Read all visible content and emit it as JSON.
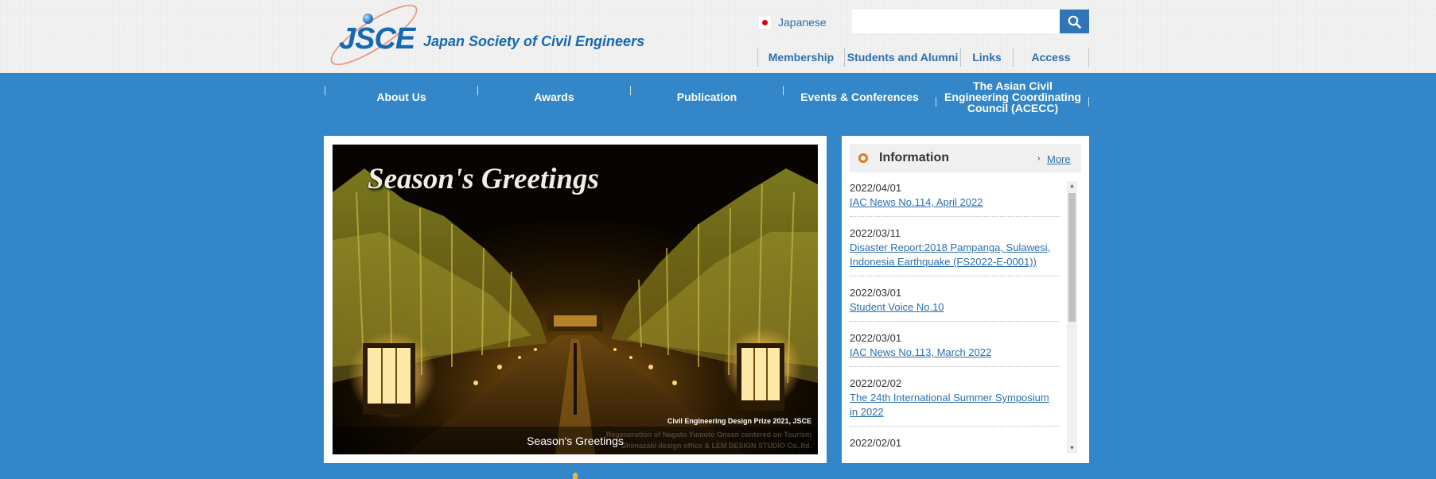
{
  "site": {
    "logo_mark": "JSCE",
    "logo_name": "Japan Society of Civil Engineers"
  },
  "language": {
    "label": "Japanese"
  },
  "search": {
    "placeholder": ""
  },
  "subnav": [
    {
      "label": "Membership"
    },
    {
      "label": "Students and Alumni"
    },
    {
      "label": "Links"
    },
    {
      "label": "Access"
    }
  ],
  "mainnav": [
    {
      "label": "About Us"
    },
    {
      "label": "Awards"
    },
    {
      "label": "Publication"
    },
    {
      "label": "Events & Conferences"
    },
    {
      "label": "The Asian Civil Engineering Coordinating Council (ACECC)"
    }
  ],
  "slider": {
    "headline": "Season's Greetings",
    "credit": "Civil Engineering Design Prize 2021, JSCE",
    "credit_line2": "Regeneration of Nagato Yumoto Onsen centered on Tourism",
    "credit_line3": "Shimazaki design office & LEM DESIGN STUDIO Co.,ltd.",
    "caption": "Season's Greetings"
  },
  "information": {
    "title": "Information",
    "more_label": "More",
    "items": [
      {
        "date": "2022/04/01",
        "link": "IAC News No.114, April 2022"
      },
      {
        "date": "2022/03/11",
        "link": "Disaster Report:2018 Pampanga, Sulawesi, Indonesia Earthquake (FS2022-E-0001))"
      },
      {
        "date": "2022/03/01",
        "link": "Student Voice No.10"
      },
      {
        "date": "2022/03/01",
        "link": "IAC News No.113, March 2022"
      },
      {
        "date": "2022/02/02",
        "link": "The 24th International Summer Symposium in 2022"
      },
      {
        "date": "2022/02/01",
        "link": ""
      }
    ]
  },
  "colors": {
    "brand_blue": "#3386c8",
    "link_blue": "#2b6fae",
    "accent_orange": "#e07a1f"
  }
}
